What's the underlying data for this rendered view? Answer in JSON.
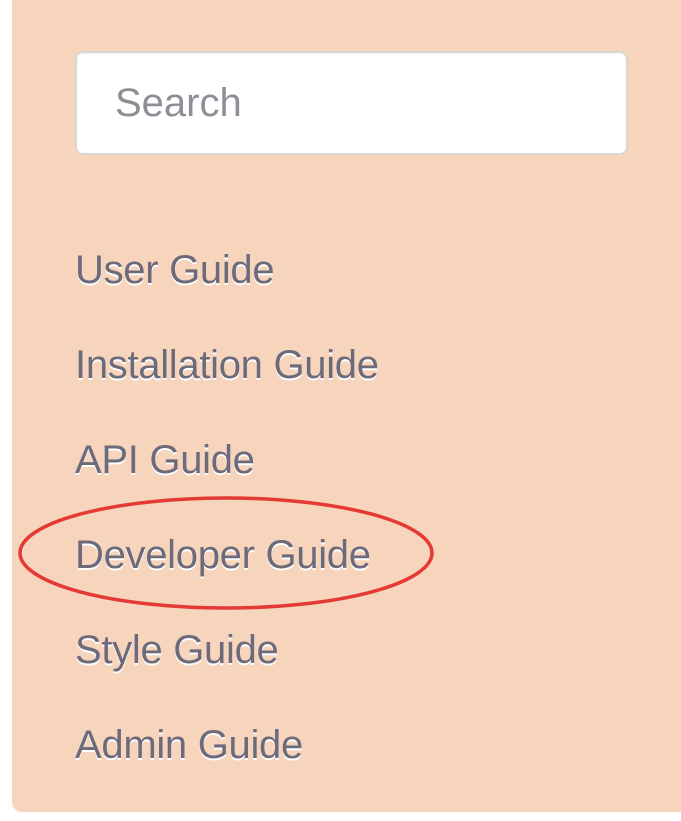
{
  "search": {
    "placeholder": "Search",
    "value": ""
  },
  "nav": {
    "items": [
      {
        "label": "User Guide"
      },
      {
        "label": "Installation Guide"
      },
      {
        "label": "API Guide"
      },
      {
        "label": "Developer Guide"
      },
      {
        "label": "Style Guide"
      },
      {
        "label": "Admin Guide"
      }
    ]
  },
  "colors": {
    "panel_background": "#f7d5bc",
    "link_text": "#6d6a7a",
    "annotation_ring": "#e53935"
  },
  "annotation": {
    "highlighted_item": "Developer Guide"
  }
}
